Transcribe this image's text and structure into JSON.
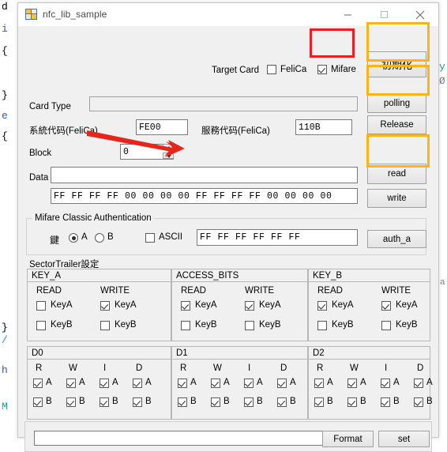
{
  "window": {
    "title": "nfc_lib_sample",
    "app_icon": "app-window-icon",
    "minimize": "─",
    "maximize": "☐",
    "close": "✕"
  },
  "target_card": {
    "label": "Target Card",
    "options": [
      {
        "label": "FeliCa",
        "checked": false
      },
      {
        "label": "Mifare",
        "checked": true
      }
    ]
  },
  "card_type": {
    "label": "Card Type",
    "value": "",
    "readonly": true
  },
  "felica_codes": {
    "system_label": "系統代码(FeliCa)",
    "system_value": "FE00",
    "service_label": "服務代码(FeliCa)",
    "service_value": "110B"
  },
  "block": {
    "label": "Block",
    "value": "0"
  },
  "data": {
    "label": "Data",
    "value": "",
    "hex_value": "FF FF FF FF 00 00 00 00 FF FF FF FF 00 00 00 00"
  },
  "right_buttons": [
    {
      "label": "初期化",
      "name": "init-button",
      "highlight": "yellow"
    },
    {
      "label": "polling",
      "name": "polling-button",
      "highlight": "yellow"
    },
    {
      "label": "Release",
      "name": "release-button",
      "highlight": "none"
    },
    {
      "label": "read",
      "name": "read-button",
      "highlight": "yellow"
    },
    {
      "label": "write",
      "name": "write-button",
      "highlight": "none"
    },
    {
      "label": "auth_a",
      "name": "auth-a-button",
      "highlight": "none"
    }
  ],
  "auth": {
    "group_label": "Mifare Classic Authentication",
    "key_label": "鍵",
    "radio_a": "A",
    "radio_b": "B",
    "radio_selected": "A",
    "ascii_label": "ASCII",
    "ascii_checked": false,
    "key_value": "FF FF FF FF FF FF",
    "auth_button": "auth_a"
  },
  "sector_trailer": {
    "label": "SectorTrailer設定",
    "panels": [
      {
        "title": "KEY_A",
        "columns": [
          {
            "header": "READ",
            "items": [
              {
                "label": "KeyA",
                "checked": false
              },
              {
                "label": "KeyB",
                "checked": false
              }
            ]
          },
          {
            "header": "WRITE",
            "items": [
              {
                "label": "KeyA",
                "checked": true
              },
              {
                "label": "KeyB",
                "checked": false
              }
            ]
          }
        ]
      },
      {
        "title": "ACCESS_BITS",
        "columns": [
          {
            "header": "READ",
            "items": [
              {
                "label": "KeyA",
                "checked": true
              },
              {
                "label": "KeyB",
                "checked": false
              }
            ]
          },
          {
            "header": "WRITE",
            "items": [
              {
                "label": "KeyA",
                "checked": true
              },
              {
                "label": "KeyB",
                "checked": false
              }
            ]
          }
        ]
      },
      {
        "title": "KEY_B",
        "columns": [
          {
            "header": "READ",
            "items": [
              {
                "label": "KeyA",
                "checked": true
              },
              {
                "label": "KeyB",
                "checked": false
              }
            ]
          },
          {
            "header": "WRITE",
            "items": [
              {
                "label": "KeyA",
                "checked": true
              },
              {
                "label": "KeyB",
                "checked": false
              }
            ]
          }
        ]
      }
    ]
  },
  "data_blocks": [
    {
      "title": "D0",
      "columns": [
        {
          "header": "R",
          "items": [
            {
              "label": "A",
              "checked": true
            },
            {
              "label": "B",
              "checked": true
            }
          ]
        },
        {
          "header": "W",
          "items": [
            {
              "label": "A",
              "checked": true
            },
            {
              "label": "B",
              "checked": true
            }
          ]
        },
        {
          "header": "I",
          "items": [
            {
              "label": "A",
              "checked": true
            },
            {
              "label": "B",
              "checked": true
            }
          ]
        },
        {
          "header": "D",
          "items": [
            {
              "label": "A",
              "checked": true
            },
            {
              "label": "B",
              "checked": true
            }
          ]
        }
      ]
    },
    {
      "title": "D1",
      "columns": [
        {
          "header": "R",
          "items": [
            {
              "label": "A",
              "checked": true
            },
            {
              "label": "B",
              "checked": true
            }
          ]
        },
        {
          "header": "W",
          "items": [
            {
              "label": "A",
              "checked": true
            },
            {
              "label": "B",
              "checked": true
            }
          ]
        },
        {
          "header": "I",
          "items": [
            {
              "label": "A",
              "checked": true
            },
            {
              "label": "B",
              "checked": true
            }
          ]
        },
        {
          "header": "D",
          "items": [
            {
              "label": "A",
              "checked": true
            },
            {
              "label": "B",
              "checked": true
            }
          ]
        }
      ]
    },
    {
      "title": "D2",
      "columns": [
        {
          "header": "R",
          "items": [
            {
              "label": "A",
              "checked": true
            },
            {
              "label": "B",
              "checked": true
            }
          ]
        },
        {
          "header": "W",
          "items": [
            {
              "label": "A",
              "checked": true
            },
            {
              "label": "B",
              "checked": true
            }
          ]
        },
        {
          "header": "I",
          "items": [
            {
              "label": "A",
              "checked": true
            },
            {
              "label": "B",
              "checked": true
            }
          ]
        },
        {
          "header": "D",
          "items": [
            {
              "label": "A",
              "checked": true
            },
            {
              "label": "B",
              "checked": true
            }
          ]
        }
      ]
    }
  ],
  "footer": {
    "input_value": "",
    "format_button": "Format",
    "set_button": "set"
  },
  "annotations": {
    "arrow_color": "#e8251b",
    "red_box_color": "#ee1c25",
    "yellow_box_color": "#fcb415"
  },
  "background_code": [
    {
      "text": "d",
      "class": ""
    },
    {
      "text": "i",
      "class": "c-blue"
    },
    {
      "text": "{",
      "class": ""
    },
    {
      "text": "}",
      "class": ""
    },
    {
      "text": "e",
      "class": "c-blue"
    },
    {
      "text": "{",
      "class": ""
    },
    {
      "text": "}",
      "class": ""
    },
    {
      "text": "/",
      "class": "c-teal"
    },
    {
      "text": "h",
      "class": "c-blue"
    },
    {
      "text": "M",
      "class": "c-teal"
    },
    {
      "text": "y",
      "class": "c-teal"
    },
    {
      "text": "Ø",
      "class": "c-gray"
    },
    {
      "text": "a",
      "class": "c-gray"
    }
  ]
}
